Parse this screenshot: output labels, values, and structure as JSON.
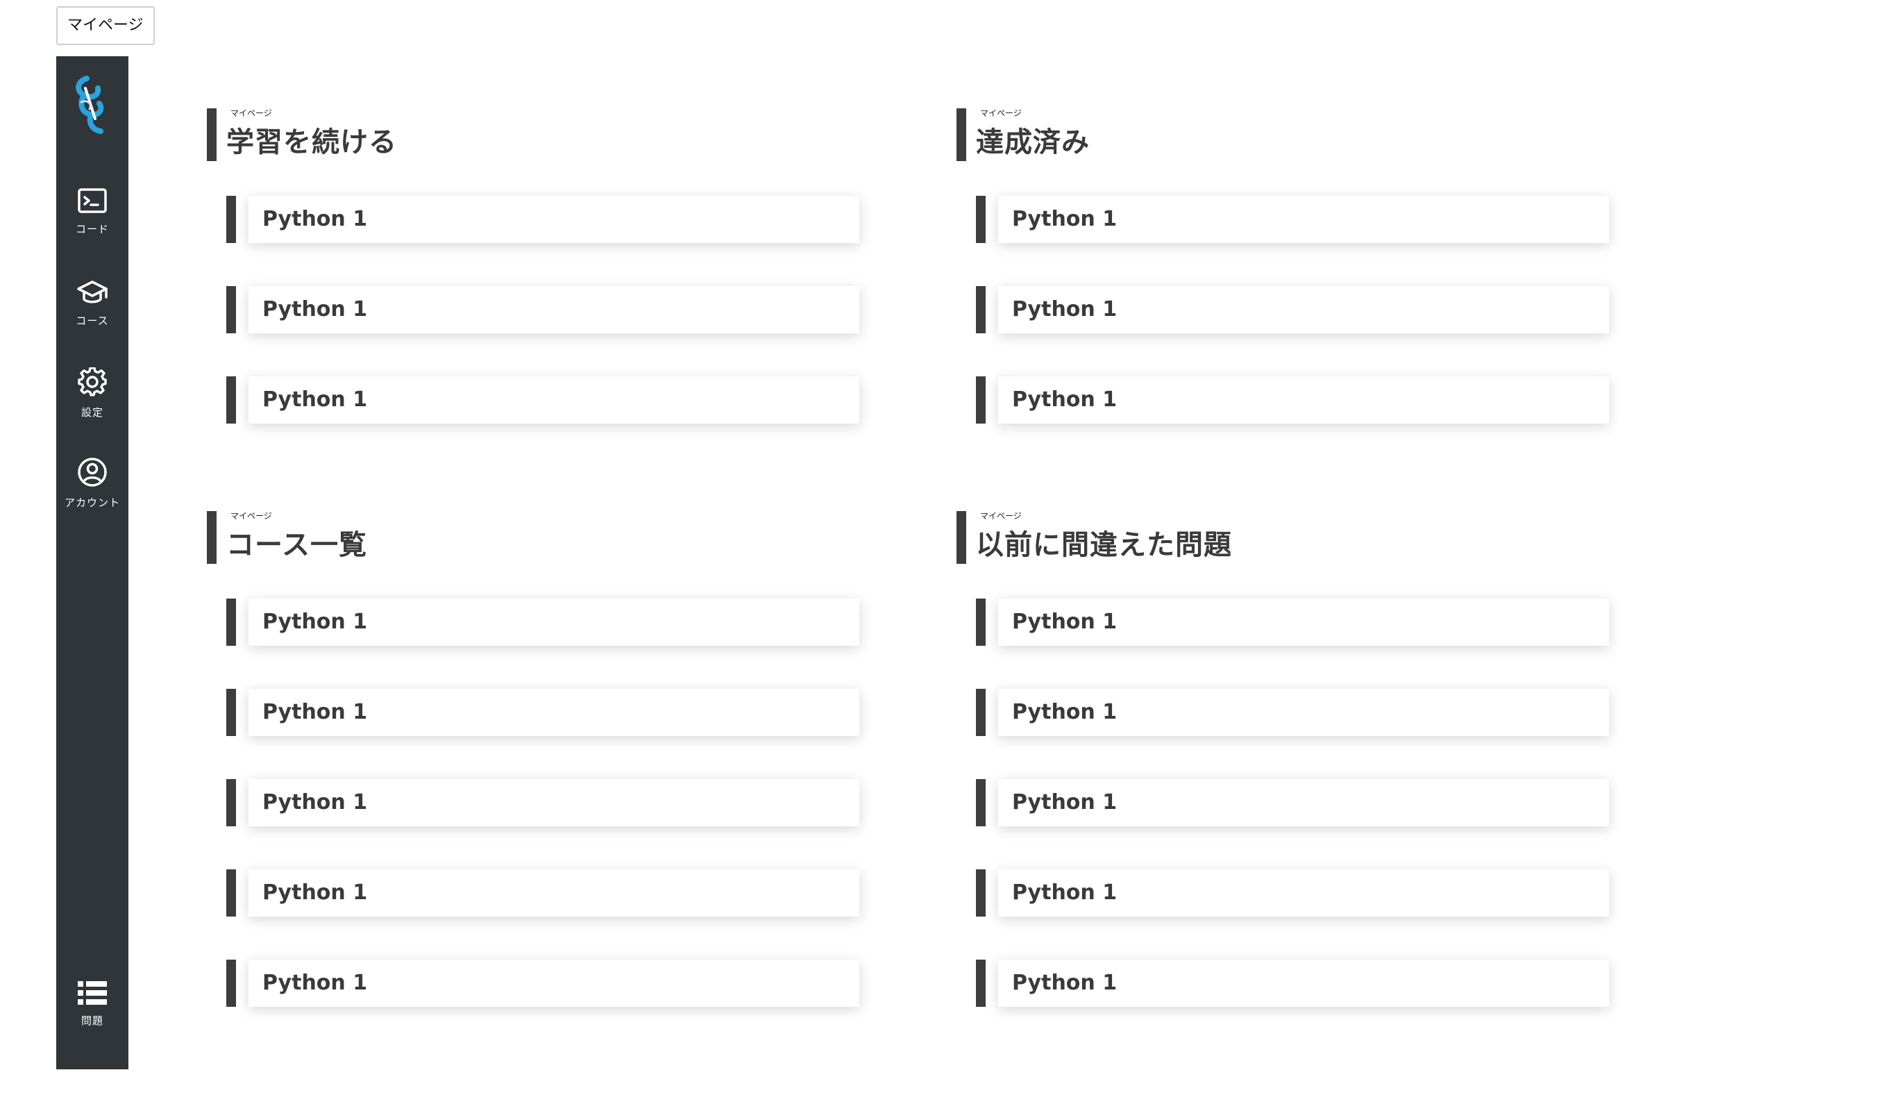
{
  "page_tab": "マイページ",
  "colors": {
    "sidebar_bg": "#2f3538",
    "accent_bar": "#3d3d3d",
    "logo_blue": "#29a3dd"
  },
  "sidebar": {
    "logo_icon": "spiral-logo-icon",
    "items": [
      {
        "label": "コード",
        "icon": "terminal-icon"
      },
      {
        "label": "コース",
        "icon": "graduation-cap-icon"
      },
      {
        "label": "設定",
        "icon": "gear-icon"
      },
      {
        "label": "アカウント",
        "icon": "account-circle-icon"
      }
    ],
    "bottom_item": {
      "label": "問題",
      "icon": "list-icon"
    }
  },
  "sections": [
    {
      "kicker": "マイページ",
      "title": "学習を続ける",
      "items": [
        "Python 1",
        "Python 1",
        "Python 1"
      ]
    },
    {
      "kicker": "マイページ",
      "title": "達成済み",
      "items": [
        "Python 1",
        "Python 1",
        "Python 1"
      ]
    },
    {
      "kicker": "マイページ",
      "title": "コース一覧",
      "items": [
        "Python 1",
        "Python 1",
        "Python 1",
        "Python 1",
        "Python 1"
      ]
    },
    {
      "kicker": "マイページ",
      "title": "以前に間違えた問題",
      "items": [
        "Python 1",
        "Python 1",
        "Python 1",
        "Python 1",
        "Python 1"
      ]
    }
  ]
}
